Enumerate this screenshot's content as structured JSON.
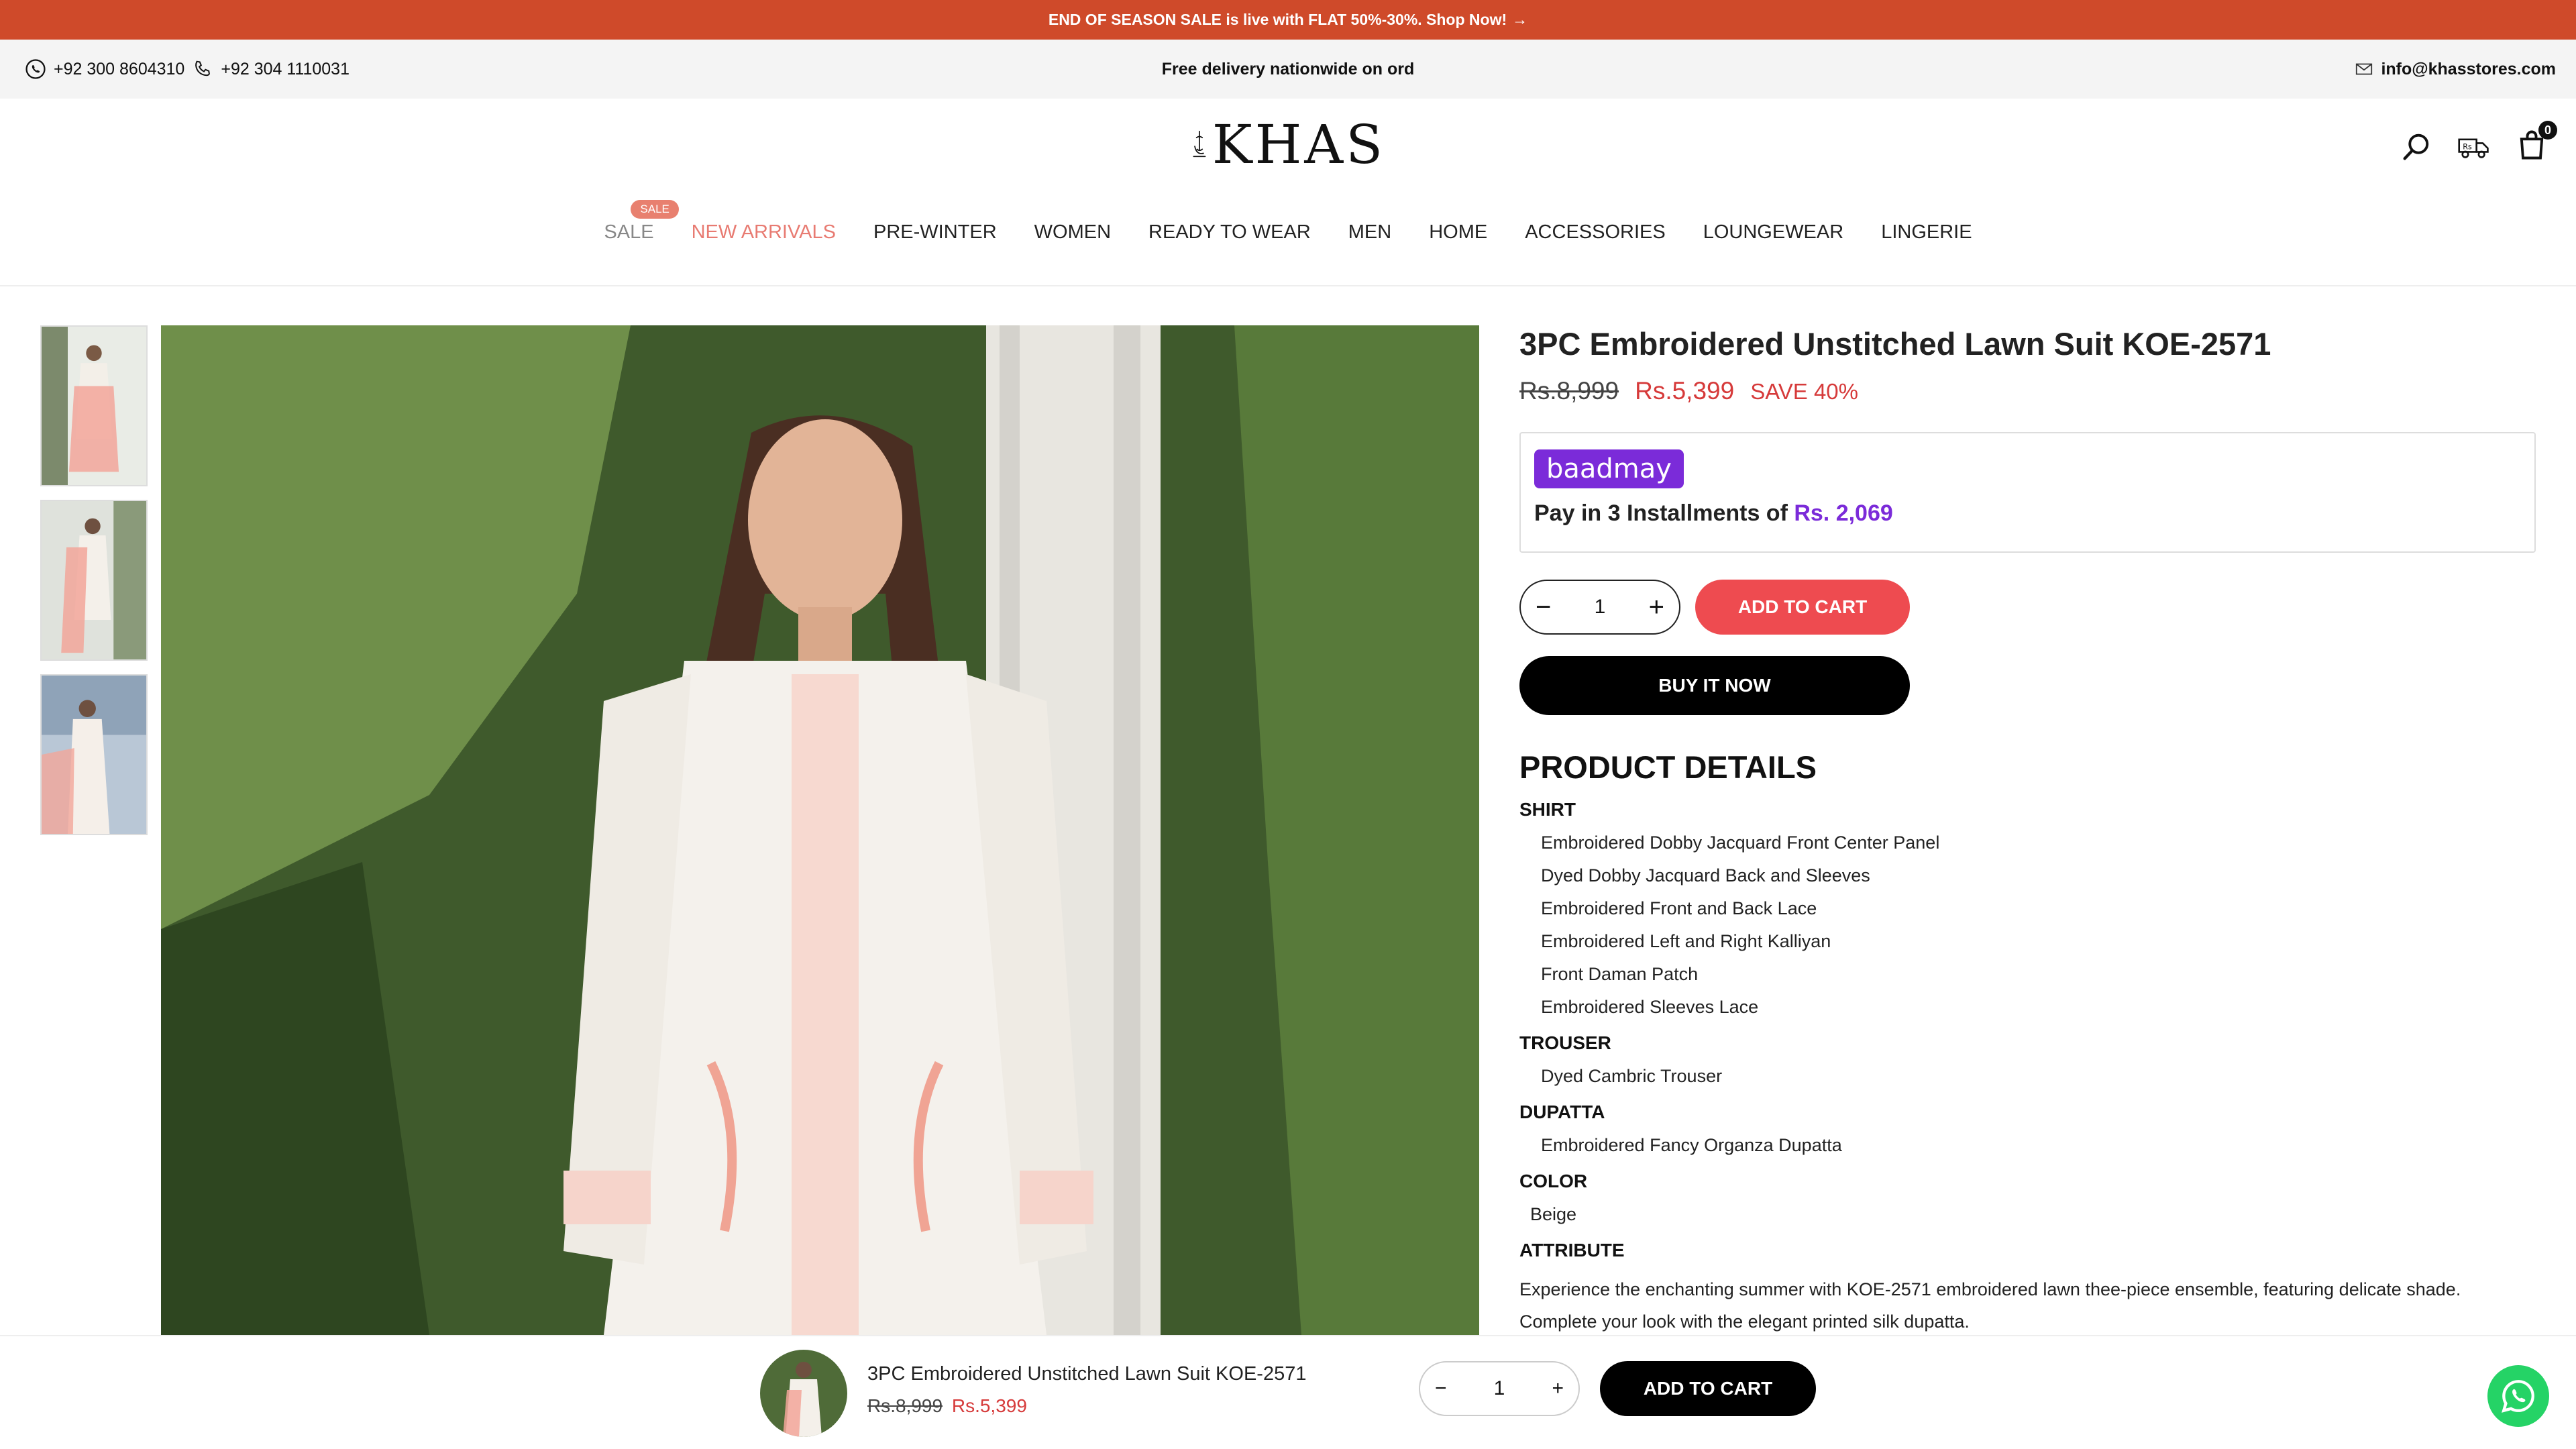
{
  "announcement": {
    "text": "END OF SEASON SALE is live with FLAT 50%-30%. Shop Now!",
    "arrow": "→"
  },
  "contact": {
    "whatsapp": "+92 300 8604310",
    "phone": "+92 304 1110031",
    "delivery": "Free delivery nationwide on ord",
    "email": "info@khasstores.com"
  },
  "header": {
    "logo_text": "KHAS",
    "cart_count": "0"
  },
  "nav": {
    "sale_badge": "SALE",
    "items": [
      "SALE",
      "NEW ARRIVALS",
      "PRE-WINTER",
      "WOMEN",
      "READY TO WEAR",
      "MEN",
      "HOME",
      "ACCESSORIES",
      "LOUNGEWEAR",
      "LINGERIE"
    ]
  },
  "product": {
    "title": "3PC Embroidered Unstitched Lawn Suit KOE-2571",
    "compare_price": "Rs.8,999",
    "price": "Rs.5,399",
    "save": "SAVE 40%",
    "baadmay_brand": "baadmay",
    "installment_text": "Pay in 3 Installments of",
    "installment_amount": "Rs. 2,069",
    "quantity": "1",
    "add_to_cart": "ADD TO CART",
    "buy_now": "BUY IT NOW"
  },
  "details": {
    "heading": "PRODUCT DETAILS",
    "shirt_h": "SHIRT",
    "shirt": [
      "Embroidered Dobby Jacquard Front Center Panel",
      "Dyed Dobby Jacquard Back and Sleeves",
      "Embroidered Front and Back Lace",
      "Embroidered Left and Right Kalliyan",
      "Front Daman Patch",
      "Embroidered Sleeves Lace"
    ],
    "trouser_h": "TROUSER",
    "trouser": [
      "Dyed Cambric Trouser"
    ],
    "dupatta_h": "DUPATTA",
    "dupatta": [
      "Embroidered Fancy Organza Dupatta"
    ],
    "color_h": "COLOR",
    "color": "Beige",
    "attribute_h": "ATTRIBUTE",
    "attribute_1": "Experience the enchanting summer with KOE-2571 embroidered lawn thee-piece ensemble, featuring delicate shade.",
    "attribute_2": "Complete your look with the elegant printed silk dupatta."
  },
  "sticky": {
    "title": "3PC Embroidered Unstitched Lawn Suit KOE-2571",
    "compare_price": "Rs.8,999",
    "price": "Rs.5,399",
    "quantity": "1",
    "add_to_cart": "ADD TO CART"
  },
  "colors": {
    "announce": "#cf4a2a",
    "sale_red": "#d63a3a",
    "baadmay": "#7b2bd9",
    "add_cart": "#ee4b50",
    "whatsapp": "#25d366"
  },
  "icons": [
    "whatsapp-icon",
    "phone-icon",
    "mail-icon",
    "search-icon",
    "delivery-truck-icon",
    "cart-icon"
  ]
}
